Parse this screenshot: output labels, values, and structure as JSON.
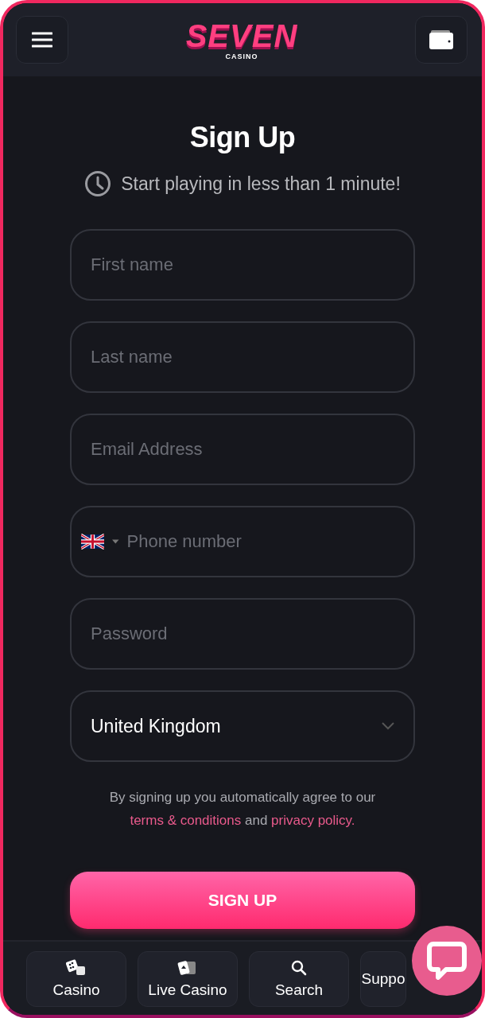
{
  "header": {
    "logo": {
      "title": "SEVEN",
      "subtitle": "CASINO"
    }
  },
  "form": {
    "title": "Sign Up",
    "subtitle": "Start playing in less than 1 minute!",
    "fields": [
      {
        "kind": "text",
        "placeholder": "First name"
      },
      {
        "kind": "text",
        "placeholder": "Last name"
      },
      {
        "kind": "text",
        "placeholder": "Email Address"
      },
      {
        "kind": "phone",
        "placeholder": "Phone number"
      },
      {
        "kind": "password",
        "placeholder": "Password"
      },
      {
        "kind": "select",
        "value": "United Kingdom"
      }
    ],
    "terms": [
      {
        "kind": "text",
        "text": "By signing up you automatically agree to our "
      },
      {
        "kind": "link",
        "text": "terms & conditions"
      },
      {
        "kind": "text",
        "text": " and "
      },
      {
        "kind": "link",
        "text": "privacy policy."
      }
    ],
    "submit": "SIGN UP"
  },
  "bottom_nav": [
    {
      "label": "Casino"
    },
    {
      "label": "Live Casino"
    },
    {
      "label": "Search"
    },
    {
      "label": "Suppo"
    }
  ]
}
